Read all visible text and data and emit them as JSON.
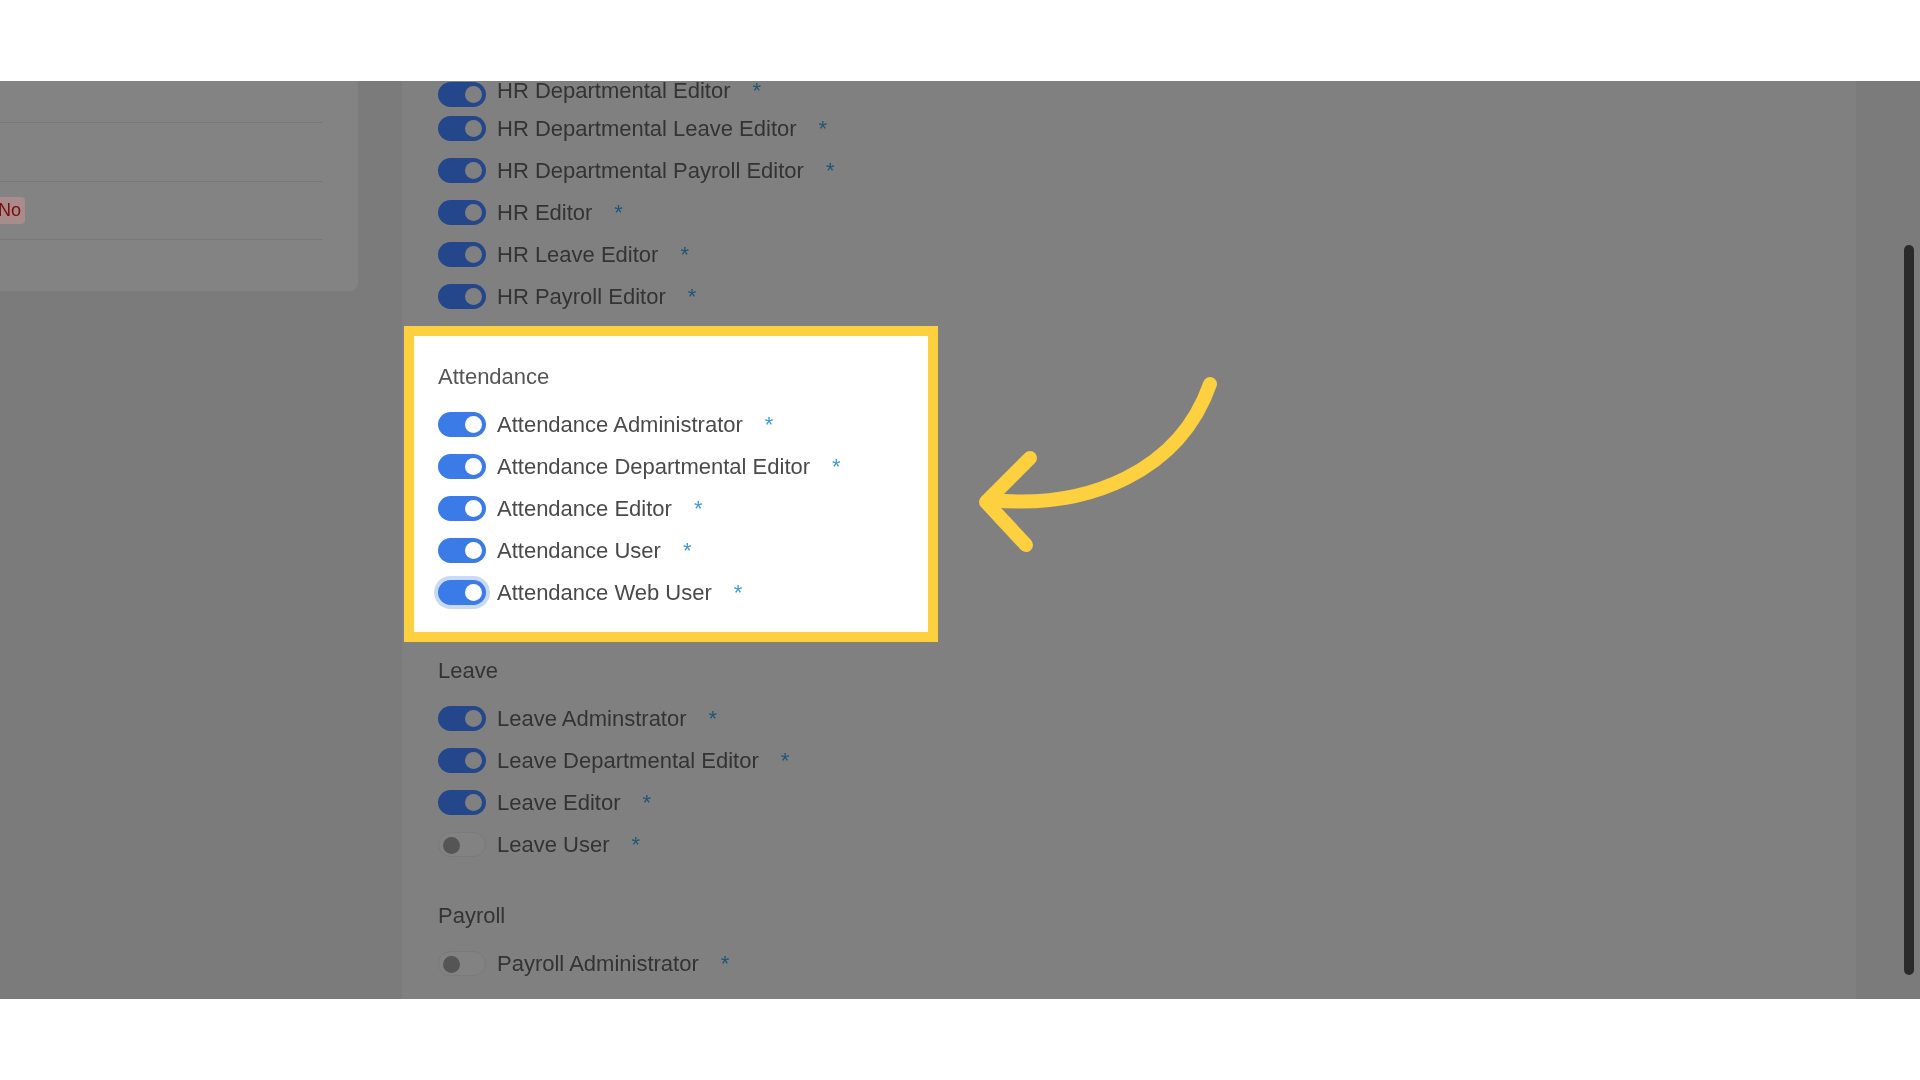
{
  "side_panel": {
    "badge": "No"
  },
  "groups": [
    {
      "highlighted": false,
      "roles": [
        {
          "label": "HR Departmental Editor",
          "on": true,
          "focused": false,
          "mark": "*"
        },
        {
          "label": "HR Departmental Leave Editor",
          "on": true,
          "focused": false,
          "mark": "*"
        },
        {
          "label": "HR Departmental Payroll Editor",
          "on": true,
          "focused": false,
          "mark": "*"
        },
        {
          "label": "HR Editor",
          "on": true,
          "focused": false,
          "mark": "*"
        },
        {
          "label": "HR Leave Editor",
          "on": true,
          "focused": false,
          "mark": "*"
        },
        {
          "label": "HR Payroll Editor",
          "on": true,
          "focused": false,
          "mark": "*"
        }
      ]
    },
    {
      "heading": "Attendance",
      "highlighted": true,
      "roles": [
        {
          "label": "Attendance Administrator",
          "on": true,
          "focused": false,
          "mark": "*"
        },
        {
          "label": "Attendance Departmental Editor",
          "on": true,
          "focused": false,
          "mark": "*"
        },
        {
          "label": "Attendance Editor",
          "on": true,
          "focused": false,
          "mark": "*"
        },
        {
          "label": "Attendance User",
          "on": true,
          "focused": false,
          "mark": "*"
        },
        {
          "label": "Attendance Web User",
          "on": true,
          "focused": true,
          "mark": "*"
        }
      ]
    },
    {
      "heading": "Leave",
      "highlighted": false,
      "roles": [
        {
          "label": "Leave Adminstrator",
          "on": true,
          "focused": false,
          "mark": "*"
        },
        {
          "label": "Leave Departmental Editor",
          "on": true,
          "focused": false,
          "mark": "*"
        },
        {
          "label": "Leave Editor",
          "on": true,
          "focused": false,
          "mark": "*"
        },
        {
          "label": "Leave User",
          "on": false,
          "focused": false,
          "mark": "*"
        }
      ]
    },
    {
      "heading": "Payroll",
      "highlighted": false,
      "roles": [
        {
          "label": "Payroll Administrator",
          "on": false,
          "focused": false,
          "mark": "*"
        }
      ]
    }
  ]
}
